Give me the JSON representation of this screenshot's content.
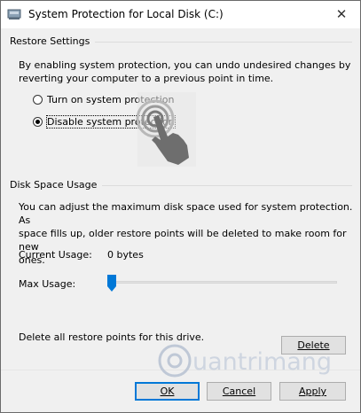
{
  "window": {
    "title": "System Protection for Local Disk (C:)",
    "close_glyph": "✕",
    "app_icon": "drive-protection-icon"
  },
  "restore_settings": {
    "group_title": "Restore Settings",
    "description_line1": "By enabling system protection, you can undo undesired changes by",
    "description_line2": "reverting your computer to a previous point in time.",
    "options": [
      {
        "label": "Turn on system protection",
        "selected": false
      },
      {
        "label": "Disable system protection",
        "selected": true
      }
    ]
  },
  "disk_space": {
    "group_title": "Disk Space Usage",
    "description_line1": "You can adjust the maximum disk space used for system protection. As",
    "description_line2": "space fills up, older restore points will be deleted to make room for new",
    "description_line3": "ones.",
    "current_usage_label": "Current Usage:",
    "current_usage_value": "0 bytes",
    "max_usage_label": "Max Usage:",
    "max_usage_level": 0,
    "delete_text": "Delete all restore points for this drive.",
    "delete_button": "Delete"
  },
  "footer": {
    "ok": "OK",
    "cancel": "Cancel",
    "apply": "Apply"
  },
  "overlay": {
    "pointer": "touch-hand-icon",
    "watermark": "uantrimang",
    "accent_blue": "#0078d7"
  }
}
